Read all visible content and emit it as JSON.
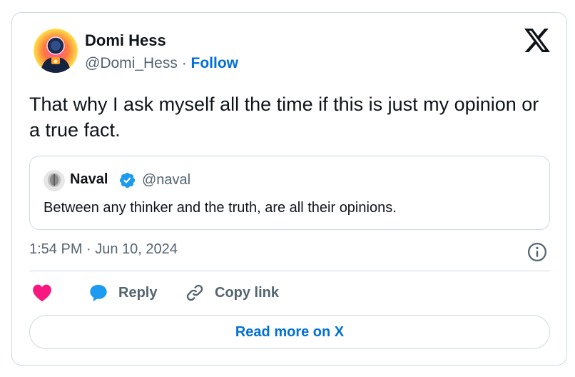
{
  "tweet": {
    "author_name": "Domi Hess",
    "author_handle": "@Domi_Hess",
    "separator": " · ",
    "follow_label": "Follow",
    "text": "That why I ask myself all the time if this is just my opinion or a true fact.",
    "timestamp": "1:54 PM · Jun 10, 2024"
  },
  "quoted_tweet": {
    "author_name": "Naval",
    "author_handle": "@naval",
    "text": "Between any thinker and the truth, are all their opinions."
  },
  "actions": {
    "like_icon": "heart-icon",
    "reply_label": "Reply",
    "copy_link_label": "Copy link",
    "read_more_label": "Read more on X"
  },
  "colors": {
    "like": "#f91880",
    "reply": "#1d9bf0",
    "link": "#006fd6",
    "secondary_text": "#536471",
    "border": "#cfd9de"
  }
}
